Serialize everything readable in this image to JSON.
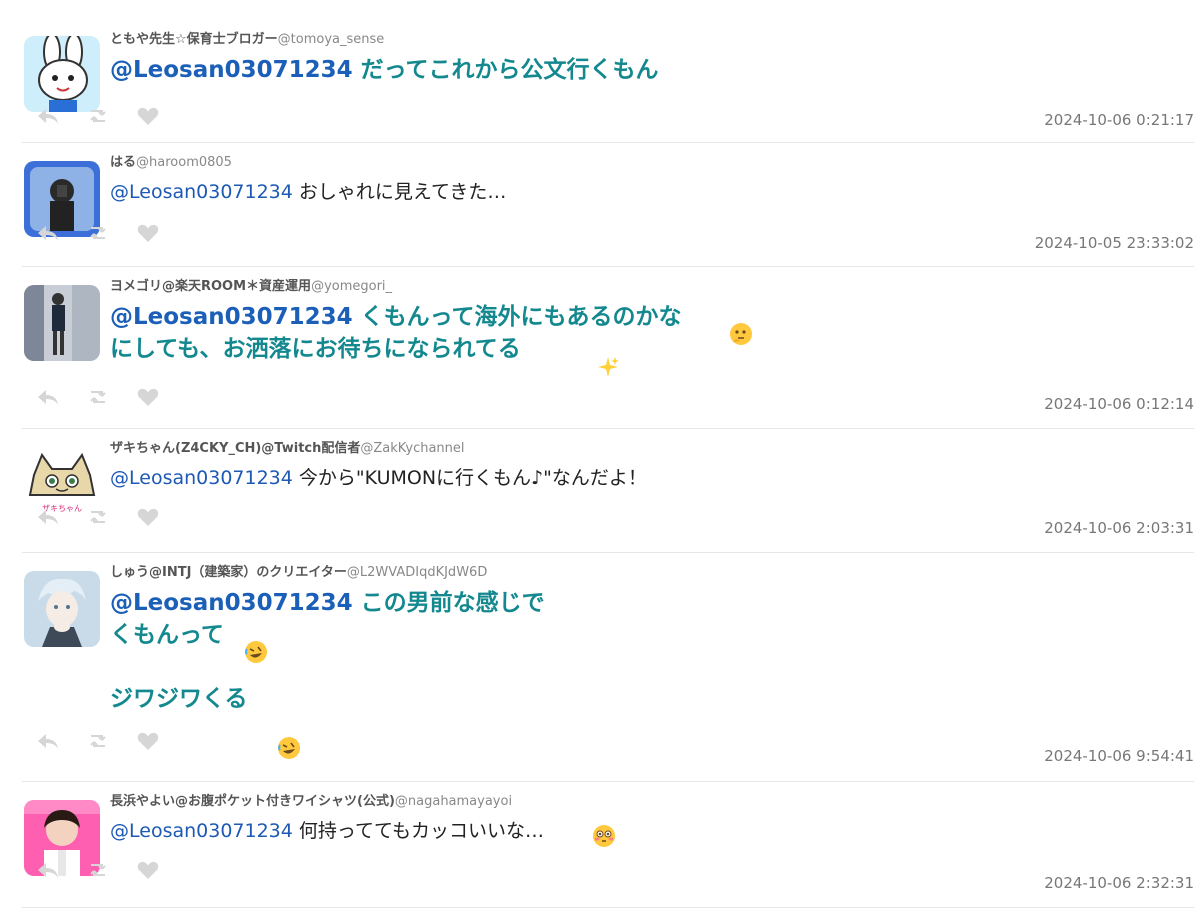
{
  "tweets": [
    {
      "user": "ともや先生☆保育士ブロガー",
      "handle": "@tomoya_sense",
      "mention": "@Leosan03071234",
      "text": " だってこれから公文行くもん",
      "time": "2024-10-06 0:21:17",
      "style": "big",
      "emoji": []
    },
    {
      "user": "はる",
      "handle": "@haroom0805",
      "mention": "@Leosan03071234",
      "text": " おしゃれに見えてきた…",
      "time": "2024-10-05 23:33:02",
      "style": "small",
      "emoji": []
    },
    {
      "user": "ヨメゴリ@楽天ROOM＊資産運用",
      "handle": "@yomegori_",
      "mention": "@Leosan03071234",
      "text": " くもんって海外にもあるのかな\nにしても、お洒落にお待ちになられてる",
      "time": "2024-10-06 0:12:14",
      "style": "big",
      "emoji": [
        "thinking-face",
        "sparkles"
      ]
    },
    {
      "user": "ザキちゃん(Z4CKY_CH)@Twitch配信者",
      "handle": "@ZakKychannel",
      "mention": "@Leosan03071234",
      "text": " 今から\"KUMONに行くもん♪\"なんだよ！",
      "time": "2024-10-06 2:03:31",
      "style": "small",
      "emoji": []
    },
    {
      "user": "しゅう@INTJ（建築家）のクリエイター",
      "handle": "@L2WVADIqdKJdW6D",
      "mention": "@Leosan03071234",
      "text": " この男前な感じで\nくもんって\n\nジワジワくる",
      "time": "2024-10-06 9:54:41",
      "style": "big",
      "emoji": [
        "rolling-laughing",
        "rolling-laughing"
      ]
    },
    {
      "user": "長浜やよい@お腹ポケット付きワイシャツ(公式)",
      "handle": "@nagahamayayoi",
      "mention": "@Leosan03071234",
      "text": " 何持っててもカッコいいな…",
      "time": "2024-10-06 2:32:31",
      "style": "small",
      "emoji": [
        "flushed-face"
      ]
    }
  ],
  "actions": {
    "reply_icon": "reply-icon",
    "retweet_icon": "retweet-icon",
    "like_icon": "heart-icon"
  },
  "colors": {
    "accent_text": "#13888f",
    "mention": "#1b5fb8",
    "icon": "#d6d6d6"
  }
}
